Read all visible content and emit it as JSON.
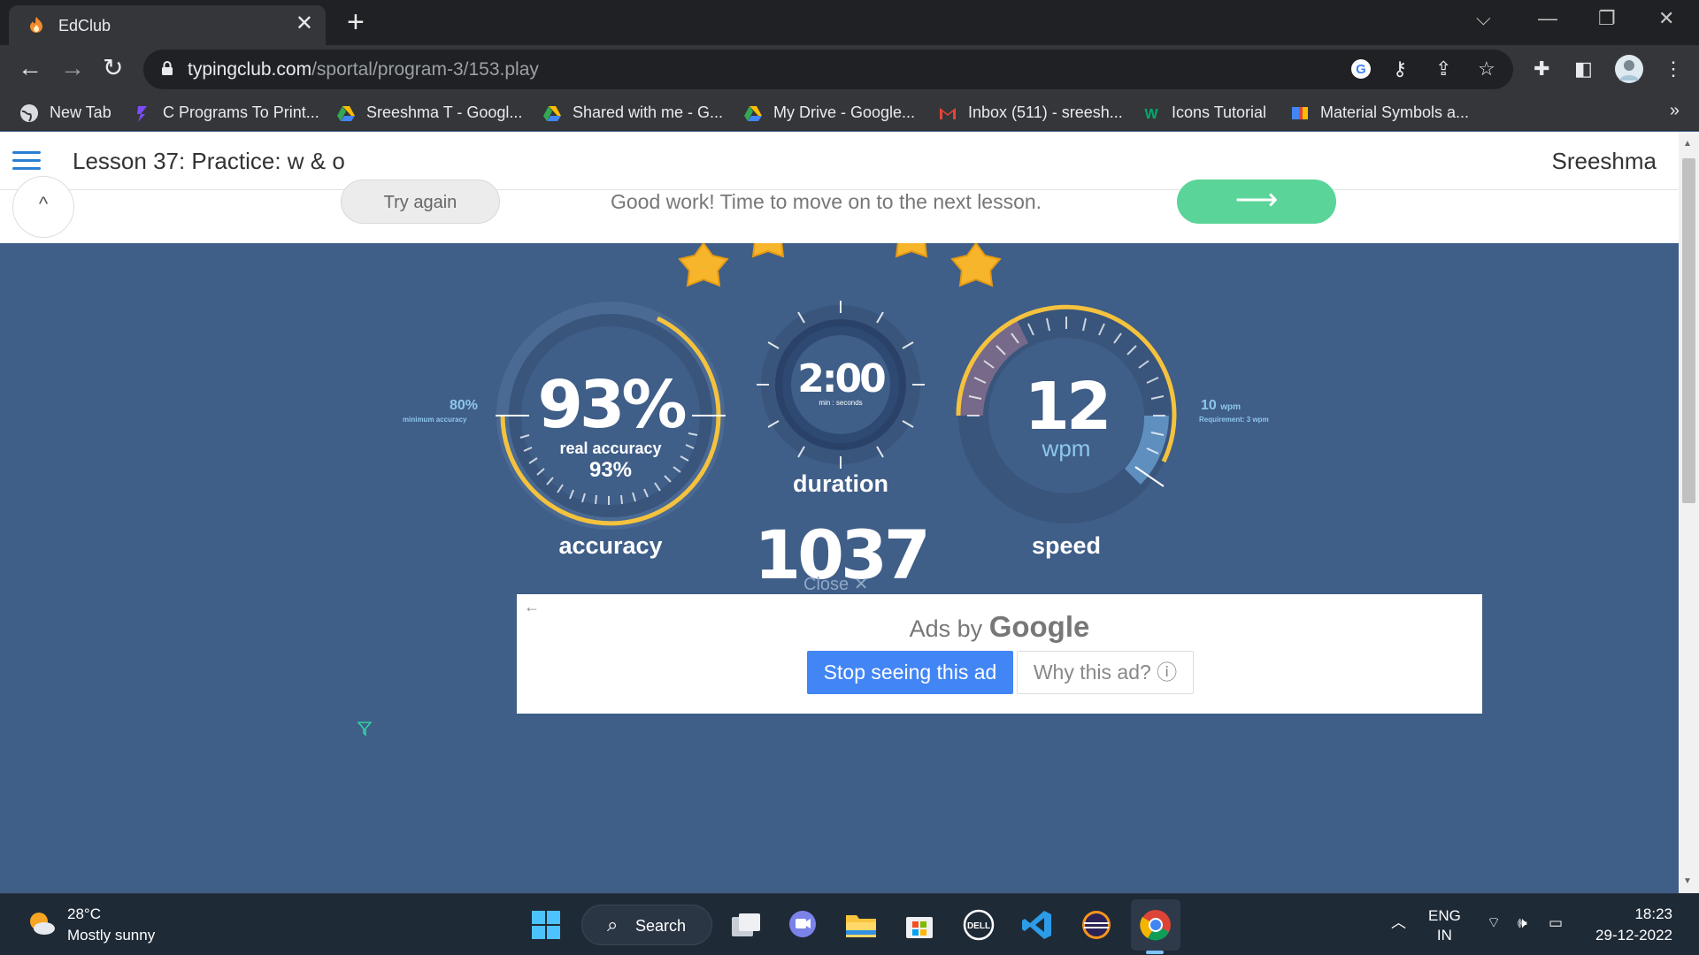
{
  "browser": {
    "tab": {
      "title": "EdClub",
      "favicon": "edclub-flame-icon"
    },
    "url": {
      "host": "typingclub.com",
      "path": "/sportal/program-3/153.play"
    },
    "bookmarks": [
      {
        "label": "New Tab",
        "icon": "globe-icon"
      },
      {
        "label": "C Programs To Print...",
        "icon": "bookmark-c-icon"
      },
      {
        "label": "Sreeshma T - Googl...",
        "icon": "google-drive-icon"
      },
      {
        "label": "Shared with me - G...",
        "icon": "google-drive-icon"
      },
      {
        "label": "My Drive - Google...",
        "icon": "google-drive-icon"
      },
      {
        "label": "Inbox (511) - sreesh...",
        "icon": "gmail-icon"
      },
      {
        "label": "Icons Tutorial",
        "icon": "w3schools-icon"
      },
      {
        "label": "Material Symbols a...",
        "icon": "material-icon"
      }
    ],
    "bookmarks_more": "»"
  },
  "page": {
    "lesson_title": "Lesson 37: Practice: w & o",
    "username": "Sreeshma",
    "results_bar": {
      "try_again": "Try again",
      "message": "Good work! Time to move on to the next lesson.",
      "next_arrow": "⟶"
    },
    "accuracy": {
      "value": "93%",
      "real_label": "real accuracy",
      "real_value": "93%",
      "label": "accuracy",
      "min_value": "80%",
      "min_label": "minimum accuracy"
    },
    "duration": {
      "value": "2:00",
      "unit": "min : seconds",
      "label": "duration"
    },
    "speed": {
      "value": "12",
      "unit": "wpm",
      "label": "speed",
      "req_value": "10",
      "req_unit": "wpm",
      "req_label": "Requirement: 3 wpm"
    },
    "score": "1037",
    "close_label": "Close",
    "ad": {
      "title_prefix": "Ads by",
      "title_brand": "Google",
      "stop_label": "Stop seeing this ad",
      "why_label": "Why this ad? ⓘ"
    }
  },
  "taskbar": {
    "weather_temp": "28°C",
    "weather_desc": "Mostly sunny",
    "search_label": "Search",
    "lang_top": "ENG",
    "lang_bottom": "IN",
    "time": "18:23",
    "date": "29-12-2022"
  },
  "colors": {
    "page_bg": "#3f5e88",
    "gauge_ring": "#f5c23d",
    "accent_green": "#5ad498",
    "accent_blue": "#4285f4"
  }
}
